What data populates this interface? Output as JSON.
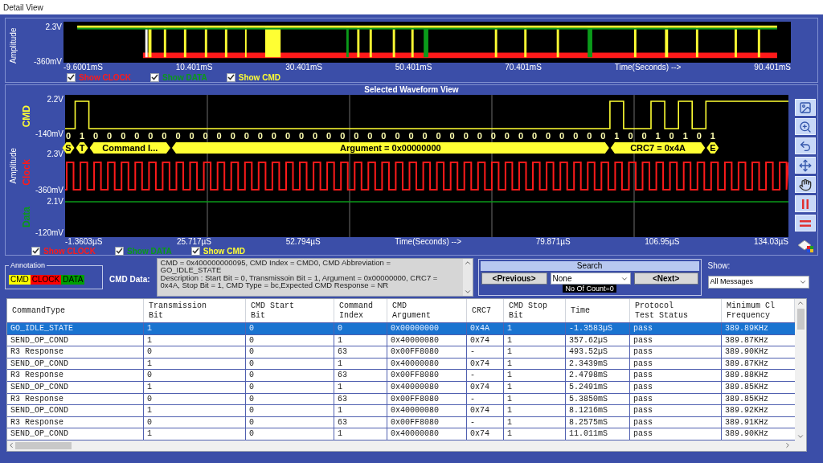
{
  "window": {
    "title": "Detail View"
  },
  "overview": {
    "axis_title": "Amplitude",
    "y_high": "2.3V",
    "y_low": "-360mV",
    "x_ticks": [
      "-9.6001mS",
      "10.401mS",
      "30.401mS",
      "50.401mS",
      "70.401mS",
      "90.401mS"
    ],
    "x_label": "Time(Seconds) -->",
    "checkboxes": [
      {
        "label": "Show CLOCK",
        "checked": true,
        "color": "#ff1a1a"
      },
      {
        "label": "Show DATA",
        "checked": true,
        "color": "#0a9a1a"
      },
      {
        "label": "Show CMD",
        "checked": true,
        "color": "#ffff33"
      }
    ]
  },
  "selected_view": {
    "title": "Selected Waveform View",
    "axis_title": "Amplitude",
    "channels": [
      {
        "name": "CMD",
        "kind": "bus",
        "color": "#ffff33",
        "high": "2.2V",
        "low": "-140mV"
      },
      {
        "name": "Clock",
        "kind": "clock",
        "color": "#ff1a1a",
        "high": "2.3V",
        "low": "-360mV"
      },
      {
        "name": "Data",
        "kind": "data",
        "color": "#0a9a1a",
        "high": "2.1V",
        "low": "-120mV"
      }
    ],
    "segments": [
      {
        "label": "S",
        "bits": [
          "0"
        ]
      },
      {
        "label": "T",
        "bits": [
          "1"
        ]
      },
      {
        "label": "Command I...",
        "bits": [
          "0",
          "0",
          "0",
          "0",
          "0",
          "0"
        ]
      },
      {
        "label": "Argument = 0x00000000",
        "bits": [
          "0",
          "0",
          "0",
          "0",
          "0",
          "0",
          "0",
          "0",
          "0",
          "0",
          "0",
          "0",
          "0",
          "0",
          "0",
          "0",
          "0",
          "0",
          "0",
          "0",
          "0",
          "0",
          "0",
          "0",
          "0",
          "0",
          "0",
          "0",
          "0",
          "0",
          "0",
          "0"
        ]
      },
      {
        "label": "CRC7 = 0x4A",
        "bits": [
          "1",
          "0",
          "0",
          "1",
          "0",
          "1",
          "0"
        ]
      },
      {
        "label": "E",
        "bits": [
          "1"
        ]
      }
    ],
    "x_ticks": [
      "-1.3603µS",
      "25.717µS",
      "52.794µS",
      "79.871µS",
      "106.95µS",
      "134.03µS"
    ],
    "x_label": "Time(Seconds) -->",
    "checkboxes": [
      {
        "label": "Show CLOCK",
        "checked": true,
        "color": "#ff1a1a"
      },
      {
        "label": "Show DATA",
        "checked": true,
        "color": "#0a9a1a"
      },
      {
        "label": "Show CMD",
        "checked": true,
        "color": "#ffff33"
      }
    ]
  },
  "annotation": {
    "title": "Annotation",
    "tags": [
      {
        "label": "CMD",
        "color": "#ffff00"
      },
      {
        "label": "CLOCK",
        "color": "#ff0000"
      },
      {
        "label": "DATA",
        "color": "#00a000"
      }
    ]
  },
  "cmd_data": {
    "label": "CMD Data:",
    "paragraphs": [
      "CMD = 0x400000000095, CMD Index = CMD0, CMD Abbreviation = GO_IDLE_STATE",
      "Description : Start Bit = 0, Transmissoin Bit = 1, Argument = 0x00000000, CRC7 = 0x4A,  Stop Bit = 1, CMD Type = bc,Expected CMD Response = NR"
    ]
  },
  "search": {
    "title": "Search",
    "previous": "<Previous>",
    "filter": "None",
    "next": "<Next>",
    "count": "No Of Count=0"
  },
  "show": {
    "label": "Show:",
    "value": "All Messages"
  },
  "table": {
    "columns": [
      {
        "lines": [
          "CommandType"
        ]
      },
      {
        "lines": [
          "Transmission",
          "Bit"
        ]
      },
      {
        "lines": [
          "CMD Start",
          "Bit"
        ]
      },
      {
        "lines": [
          "Command",
          "Index"
        ]
      },
      {
        "lines": [
          "CMD",
          "Argument"
        ]
      },
      {
        "lines": [
          "CRC7"
        ]
      },
      {
        "lines": [
          "CMD Stop",
          "Bit"
        ]
      },
      {
        "lines": [
          "Time"
        ]
      },
      {
        "lines": [
          "Protocol",
          "Test Status"
        ]
      },
      {
        "lines": [
          "Minimum Cl",
          "Frequency"
        ]
      }
    ],
    "rows": [
      {
        "selected": true,
        "cells": [
          "GO_IDLE_STATE",
          "1",
          "0",
          "0",
          "0x00000000",
          "0x4A",
          "1",
          "-1.3583µS",
          "pass",
          "389.89KHz"
        ]
      },
      {
        "selected": false,
        "cells": [
          "SEND_OP_COND",
          "1",
          "0",
          "1",
          "0x40000080",
          "0x74",
          "1",
          "357.62µS",
          "pass",
          "389.87KHz"
        ]
      },
      {
        "selected": false,
        "cells": [
          "R3 Response",
          "0",
          "0",
          "63",
          "0x00FF8080",
          "-",
          "1",
          "493.52µS",
          "pass",
          "389.90KHz"
        ]
      },
      {
        "selected": false,
        "cells": [
          "SEND_OP_COND",
          "1",
          "0",
          "1",
          "0x40000080",
          "0x74",
          "1",
          "2.3439mS",
          "pass",
          "389.87KHz"
        ]
      },
      {
        "selected": false,
        "cells": [
          "R3 Response",
          "0",
          "0",
          "63",
          "0x00FF8080",
          "-",
          "1",
          "2.4798mS",
          "pass",
          "389.88KHz"
        ]
      },
      {
        "selected": false,
        "cells": [
          "SEND_OP_COND",
          "1",
          "0",
          "1",
          "0x40000080",
          "0x74",
          "1",
          "5.2491mS",
          "pass",
          "389.85KHz"
        ]
      },
      {
        "selected": false,
        "cells": [
          "R3 Response",
          "0",
          "0",
          "63",
          "0x00FF8080",
          "-",
          "1",
          "5.3850mS",
          "pass",
          "389.85KHz"
        ]
      },
      {
        "selected": false,
        "cells": [
          "SEND_OP_COND",
          "1",
          "0",
          "1",
          "0x40000080",
          "0x74",
          "1",
          "8.1216mS",
          "pass",
          "389.92KHz"
        ]
      },
      {
        "selected": false,
        "cells": [
          "R3 Response",
          "0",
          "0",
          "63",
          "0x00FF8080",
          "-",
          "1",
          "8.2575mS",
          "pass",
          "389.91KHz"
        ]
      },
      {
        "selected": false,
        "cells": [
          "SEND_OP_COND",
          "1",
          "0",
          "1",
          "0x40000080",
          "0x74",
          "1",
          "11.011mS",
          "pass",
          "389.90KHz"
        ]
      }
    ]
  }
}
